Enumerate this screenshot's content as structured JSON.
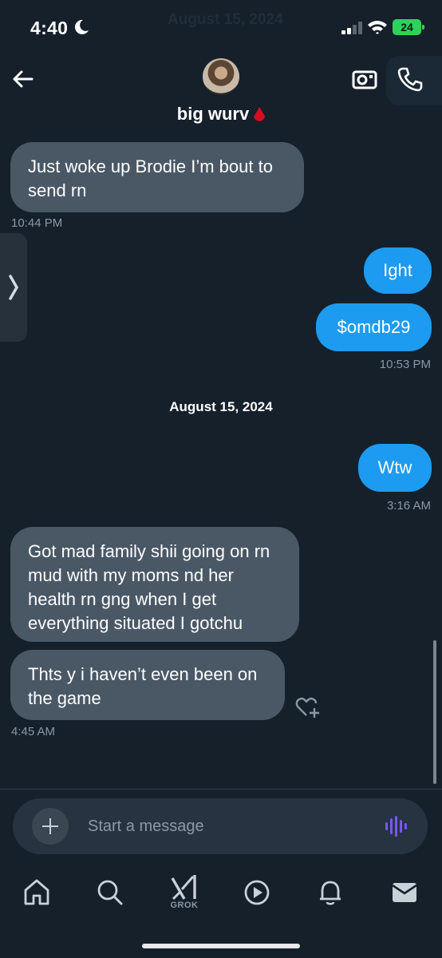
{
  "status_bar": {
    "time": "4:40",
    "ghost_date": "August 15, 2024",
    "battery": "24"
  },
  "header": {
    "title": "big wurv"
  },
  "messages": [
    {
      "type": "received",
      "text": "Just woke up Brodie I’m bout to send rn",
      "time": "10:44 PM"
    },
    {
      "type": "sent",
      "text": "Ight"
    },
    {
      "type": "sent",
      "text": "$omdb29",
      "time": "10:53 PM"
    },
    {
      "type": "date",
      "text": "August 15, 2024"
    },
    {
      "type": "sent",
      "text": "Wtw",
      "time": "3:16 AM"
    },
    {
      "type": "received",
      "text": "Got mad family shii going on rn mud with my moms nd her health rn gng when I get everything situated I gotchu"
    },
    {
      "type": "received",
      "text": "Thts y i haven’t even been on the game",
      "time": "4:45 AM"
    }
  ],
  "composer": {
    "placeholder": "Start a message"
  },
  "tabbar": {
    "grok_label": "GROK"
  },
  "colors": {
    "background": "#15202b",
    "sent_bubble": "#1d9bf0",
    "received_bubble": "#4a5866",
    "battery": "#30d158",
    "voice_icon": "#7856ff"
  },
  "icons": [
    "back-arrow-icon",
    "video-call-icon",
    "phone-icon",
    "home-icon",
    "search-icon",
    "grok-icon",
    "play-icon",
    "bell-icon",
    "mail-icon",
    "voice-wave-icon",
    "plus-icon",
    "heart-plus-icon",
    "chevron-right-icon"
  ]
}
